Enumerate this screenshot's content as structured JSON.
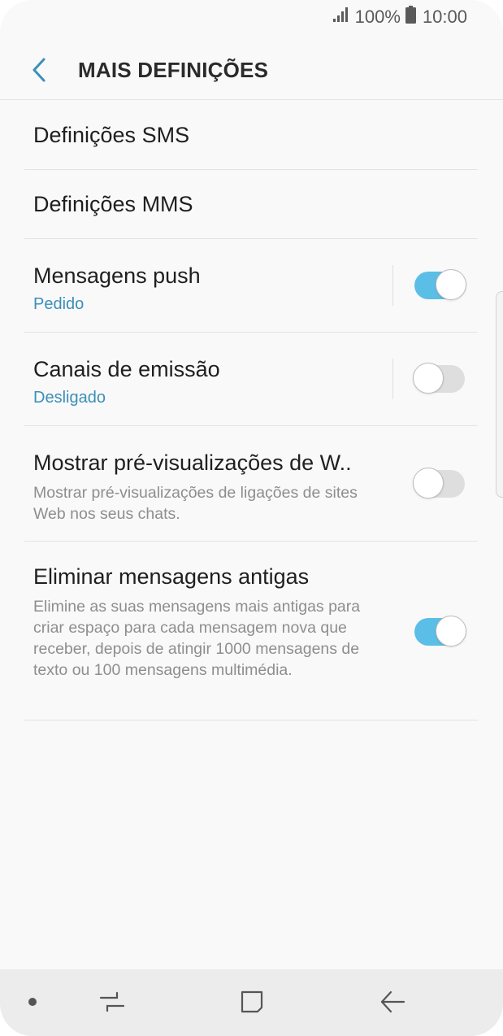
{
  "status_bar": {
    "battery_pct": "100%",
    "time": "10:00",
    "icons": [
      "signal-icon",
      "battery-icon"
    ]
  },
  "header": {
    "title": "MAIS DEFINIÇÕES",
    "back_icon": "chevron-left-icon"
  },
  "items": [
    {
      "title": "Definições SMS"
    },
    {
      "title": "Definições MMS"
    },
    {
      "title": "Mensagens push",
      "subtitle": "Pedido",
      "toggle": "on"
    },
    {
      "title": "Canais de emissão",
      "subtitle": "Desligado",
      "toggle": "off"
    },
    {
      "title": "Mostrar pré-visualizações de W..",
      "description": "Mostrar pré-visualizações de ligações de sites Web nos seus chats.",
      "toggle": "off"
    },
    {
      "title": "Eliminar mensagens antigas",
      "description": "Elimine as suas mensagens mais antigas para criar espaço para cada mensagem nova que receber, depois de atingir 1000 mensagens de texto ou 100 mensagens multimédia.",
      "toggle": "on"
    }
  ],
  "nav_bar": {
    "icons": [
      "dot-icon",
      "recents-icon",
      "home-icon",
      "back-icon"
    ]
  },
  "colors": {
    "accent": "#3b8fb8",
    "toggle_on": "#5bbee6",
    "toggle_off": "#dedede",
    "background": "#f9f9f9"
  }
}
